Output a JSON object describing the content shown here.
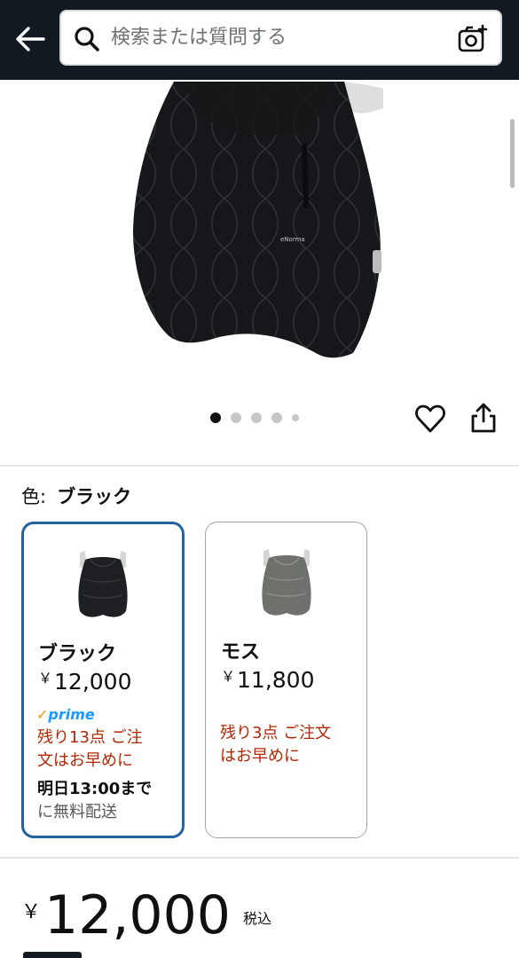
{
  "header": {
    "back_icon": "arrow-left-icon",
    "search_placeholder": "検索または質問する",
    "search_icon": "search-icon",
    "camera_icon": "camera-plus-icon"
  },
  "gallery": {
    "image_alt_product": "black quilted baby carrier cover",
    "dots_count": 5,
    "active_dot": 0,
    "wishlist_icon": "heart-icon",
    "share_icon": "share-icon"
  },
  "color": {
    "label": "色:",
    "selected_value": "ブラック"
  },
  "variants": [
    {
      "name": "ブラック",
      "price_symbol": "￥",
      "price": "12,000",
      "prime_check": "✓",
      "prime_label": "prime",
      "stock_line1": "残り13点 ご注",
      "stock_line2": "文はお早めに",
      "delivery_bold": "明日13:00まで",
      "delivery_rest": "に無料配送",
      "selected": true
    },
    {
      "name": "モス",
      "price_symbol": "￥",
      "price": "11,800",
      "stock_line1": "残り3点 ご注文",
      "stock_line2": "はお早めに",
      "selected": false
    }
  ],
  "price": {
    "symbol": "￥",
    "amount": "12,000",
    "tax_note": "税込"
  },
  "colors": {
    "header_bg": "#131921",
    "selected_border": "#2162a1",
    "stock_red": "#b12704",
    "prime_blue": "#1a98ff",
    "prime_check_orange": "#f79400"
  }
}
